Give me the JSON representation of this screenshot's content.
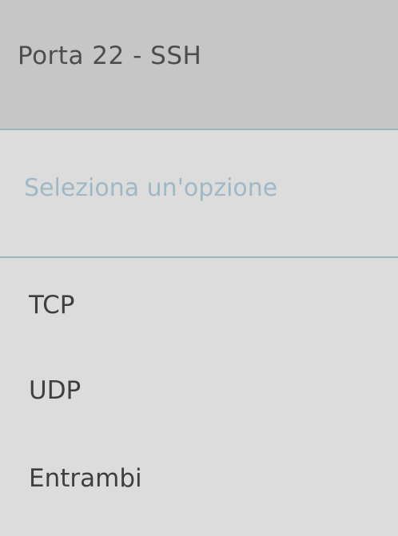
{
  "select": {
    "selected_value": "Porta 22 - SSH"
  },
  "dropdown": {
    "placeholder": "Seleziona un'opzione",
    "options": [
      {
        "label": "TCP"
      },
      {
        "label": "UDP"
      },
      {
        "label": "Entrambi"
      }
    ]
  }
}
